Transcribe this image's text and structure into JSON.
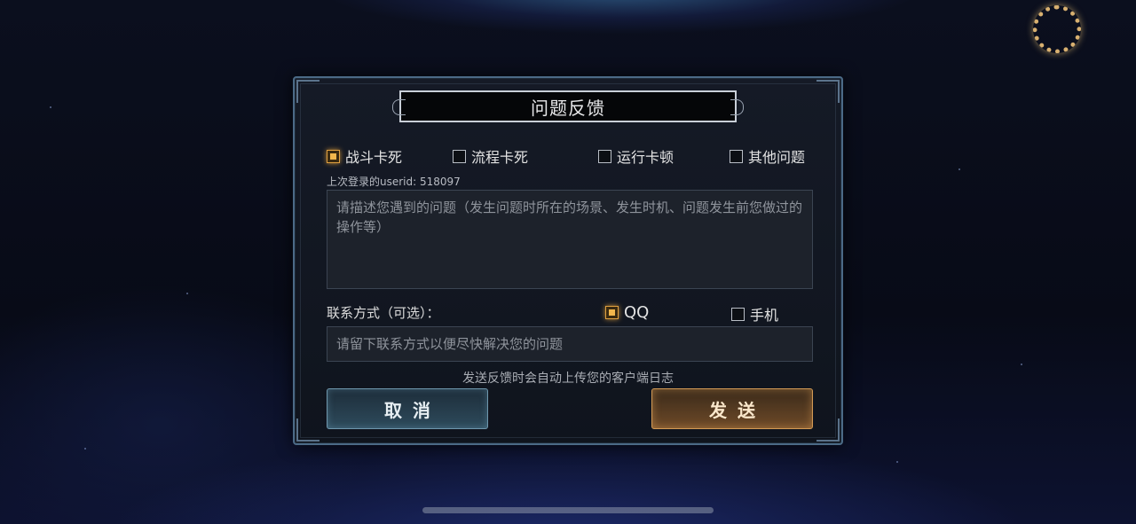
{
  "dialog": {
    "title": "问题反馈",
    "issue_types": [
      {
        "label": "战斗卡死",
        "checked": true
      },
      {
        "label": "流程卡死",
        "checked": false
      },
      {
        "label": "运行卡顿",
        "checked": false
      },
      {
        "label": "其他问题",
        "checked": false
      }
    ],
    "last_login": "上次登录的userid: 518097",
    "description_placeholder": "请描述您遇到的问题（发生问题时所在的场景、发生时机、问题发生前您做过的操作等）",
    "contact_label": "联系方式（可选）：",
    "contact_types": [
      {
        "label": "QQ",
        "checked": true
      },
      {
        "label": "手机",
        "checked": false
      }
    ],
    "contact_placeholder": "请留下联系方式以便尽快解决您的问题",
    "notice": "发送反馈时会自动上传您的客户端日志",
    "cancel_label": "取消",
    "send_label": "发送"
  },
  "colors": {
    "accent_checked": "#f2b64c",
    "cancel_border": "#6f97ad",
    "send_border": "#d39a55"
  }
}
